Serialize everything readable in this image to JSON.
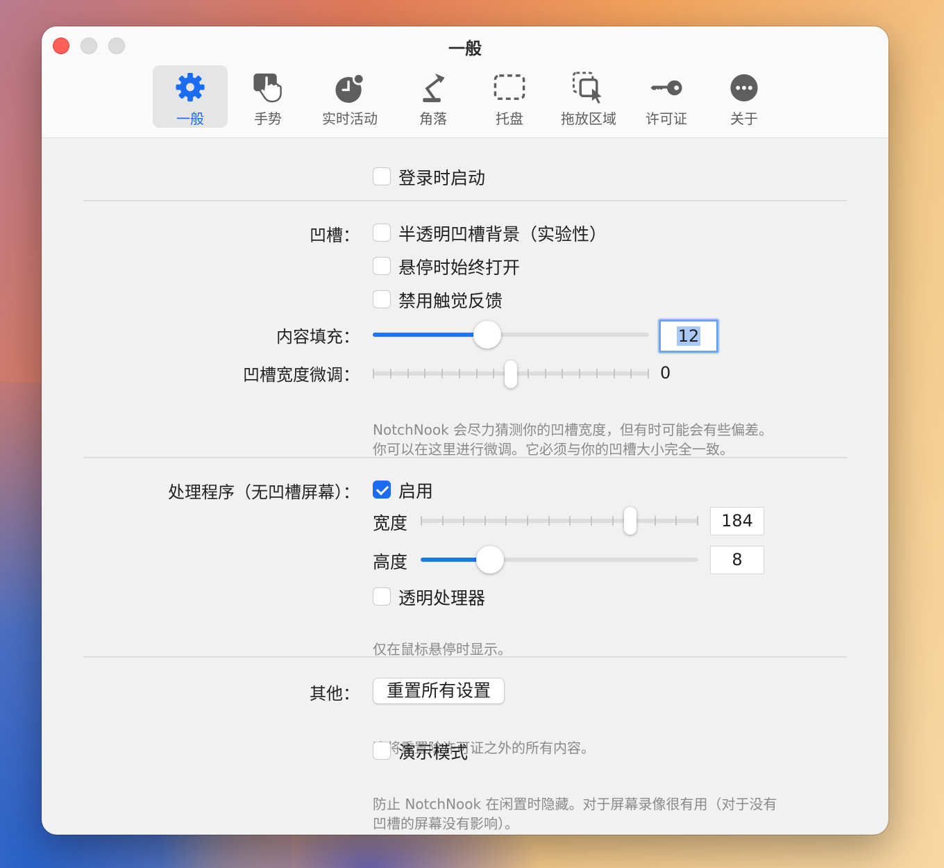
{
  "window": {
    "title": "一般"
  },
  "tabs": [
    {
      "label": "一般",
      "icon": "gear-icon",
      "active": true
    },
    {
      "label": "手势",
      "icon": "hand-pointer-icon"
    },
    {
      "label": "实时活动",
      "icon": "clock-badge-icon"
    },
    {
      "label": "角落",
      "icon": "desk-lamp-icon"
    },
    {
      "label": "托盘",
      "icon": "dashed-rectangle-icon"
    },
    {
      "label": "拖放区域",
      "icon": "drag-select-icon"
    },
    {
      "label": "许可证",
      "icon": "key-icon"
    },
    {
      "label": "关于",
      "icon": "ellipsis-circle-icon"
    }
  ],
  "general": {
    "launch_at_login": {
      "label": "登录时启动",
      "checked": false
    }
  },
  "notch": {
    "label": "凹槽：",
    "translucent": {
      "label": "半透明凹槽背景（实验性）",
      "checked": false
    },
    "hover_open": {
      "label": "悬停时始终打开",
      "checked": false
    },
    "disable_haptics": {
      "label": "禁用触觉反馈",
      "checked": false
    },
    "padding": {
      "label": "内容填充：",
      "value": "12",
      "fraction": 0.415
    },
    "width_adjust": {
      "label": "凹槽宽度微调：",
      "value": "0",
      "fraction": 0.5
    },
    "hint_line1": "NotchNook 会尽力猜测你的凹槽宽度，但有时可能会有些偏差。",
    "hint_line2": "你可以在这里进行微调。它必须与你的凹槽大小完全一致。"
  },
  "handler": {
    "label": "处理程序（无凹槽屏幕）：",
    "enable": {
      "label": "启用",
      "checked": true
    },
    "width": {
      "label": "宽度",
      "value": "184",
      "fraction": 0.755
    },
    "height": {
      "label": "高度",
      "value": "8",
      "fraction": 0.25
    },
    "transparent": {
      "label": "透明处理器",
      "checked": false
    },
    "hint": "仅在鼠标悬停时显示。"
  },
  "other": {
    "label": "其他：",
    "reset_button": "重置所有设置",
    "reset_hint": "这将重置除许可证之外的所有内容。",
    "demo_mode": {
      "label": "演示模式",
      "checked": false
    },
    "demo_hint_line1": "防止 NotchNook 在闲置时隐藏。对于屏幕录像很有用（对于没有",
    "demo_hint_line2": "凹槽的屏幕没有影响）。"
  },
  "colors": {
    "accent": "#1a6cf0",
    "close": "#fe5f57"
  }
}
